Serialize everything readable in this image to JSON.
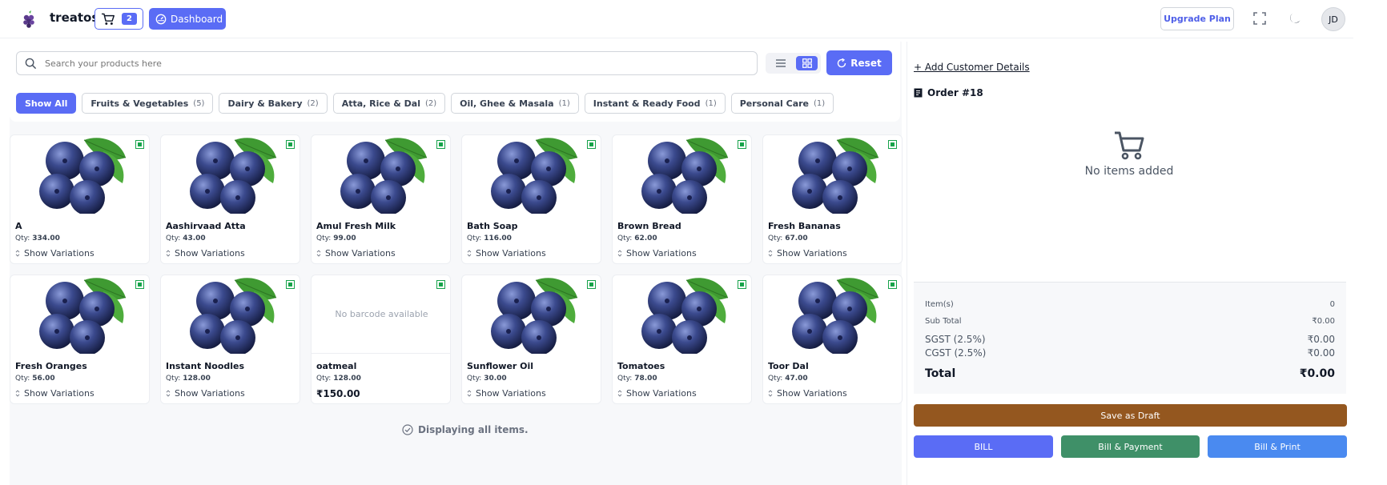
{
  "header": {
    "brand": "treatos",
    "cart_count": "2",
    "dashboard_label": "Dashboard",
    "upgrade_label": "Upgrade Plan",
    "avatar_initials": "JD"
  },
  "search": {
    "placeholder": "Search your products here",
    "value": ""
  },
  "toolbar": {
    "reset_label": "Reset"
  },
  "categories": [
    {
      "label": "Show All",
      "count": ""
    },
    {
      "label": "Fruits & Vegetables",
      "count": "(5)"
    },
    {
      "label": "Dairy & Bakery",
      "count": "(2)"
    },
    {
      "label": "Atta, Rice & Dal",
      "count": "(2)"
    },
    {
      "label": "Oil, Ghee & Masala",
      "count": "(1)"
    },
    {
      "label": "Instant & Ready Food",
      "count": "(1)"
    },
    {
      "label": "Personal Care",
      "count": "(1)"
    }
  ],
  "products": [
    {
      "name": "A",
      "qty_label": "Qty:",
      "qty": "334.00",
      "action": "Show Variations"
    },
    {
      "name": "Aashirvaad Atta",
      "qty_label": "Qty:",
      "qty": "43.00",
      "action": "Show Variations"
    },
    {
      "name": "Amul Fresh Milk",
      "qty_label": "Qty:",
      "qty": "99.00",
      "action": "Show Variations"
    },
    {
      "name": "Bath Soap",
      "qty_label": "Qty:",
      "qty": "116.00",
      "action": "Show Variations"
    },
    {
      "name": "Brown Bread",
      "qty_label": "Qty:",
      "qty": "62.00",
      "action": "Show Variations"
    },
    {
      "name": "Fresh Bananas",
      "qty_label": "Qty:",
      "qty": "67.00",
      "action": "Show Variations"
    },
    {
      "name": "Fresh Oranges",
      "qty_label": "Qty:",
      "qty": "56.00",
      "action": "Show Variations"
    },
    {
      "name": "Instant Noodles",
      "qty_label": "Qty:",
      "qty": "128.00",
      "action": "Show Variations"
    },
    {
      "name": "oatmeal",
      "qty_label": "Qty:",
      "qty": "128.00",
      "no_image_text": "No barcode available",
      "price": "₹150.00"
    },
    {
      "name": "Sunflower Oil",
      "qty_label": "Qty:",
      "qty": "30.00",
      "action": "Show Variations"
    },
    {
      "name": "Tomatoes",
      "qty_label": "Qty:",
      "qty": "78.00",
      "action": "Show Variations"
    },
    {
      "name": "Toor Dal",
      "qty_label": "Qty:",
      "qty": "47.00",
      "action": "Show Variations"
    }
  ],
  "grid_footer": "Displaying all items.",
  "order": {
    "add_customer": "+ Add Customer Details",
    "title": "Order #18",
    "empty_text": "No items added",
    "summary": {
      "items_label": "Item(s)",
      "items_value": "0",
      "subtotal_label": "Sub Total",
      "subtotal_value": "₹0.00",
      "sgst_label": "SGST (2.5%)",
      "sgst_value": "₹0.00",
      "cgst_label": "CGST (2.5%)",
      "cgst_value": "₹0.00",
      "total_label": "Total",
      "total_value": "₹0.00"
    },
    "save_draft": "Save as Draft",
    "bill": "BILL",
    "bill_payment": "Bill & Payment",
    "bill_print": "Bill & Print"
  },
  "colors": {
    "primary": "#5a6cf5",
    "draft": "#94571f",
    "payment": "#3f9068",
    "print": "#4a8af0",
    "veg_mark": "#16a34a"
  }
}
